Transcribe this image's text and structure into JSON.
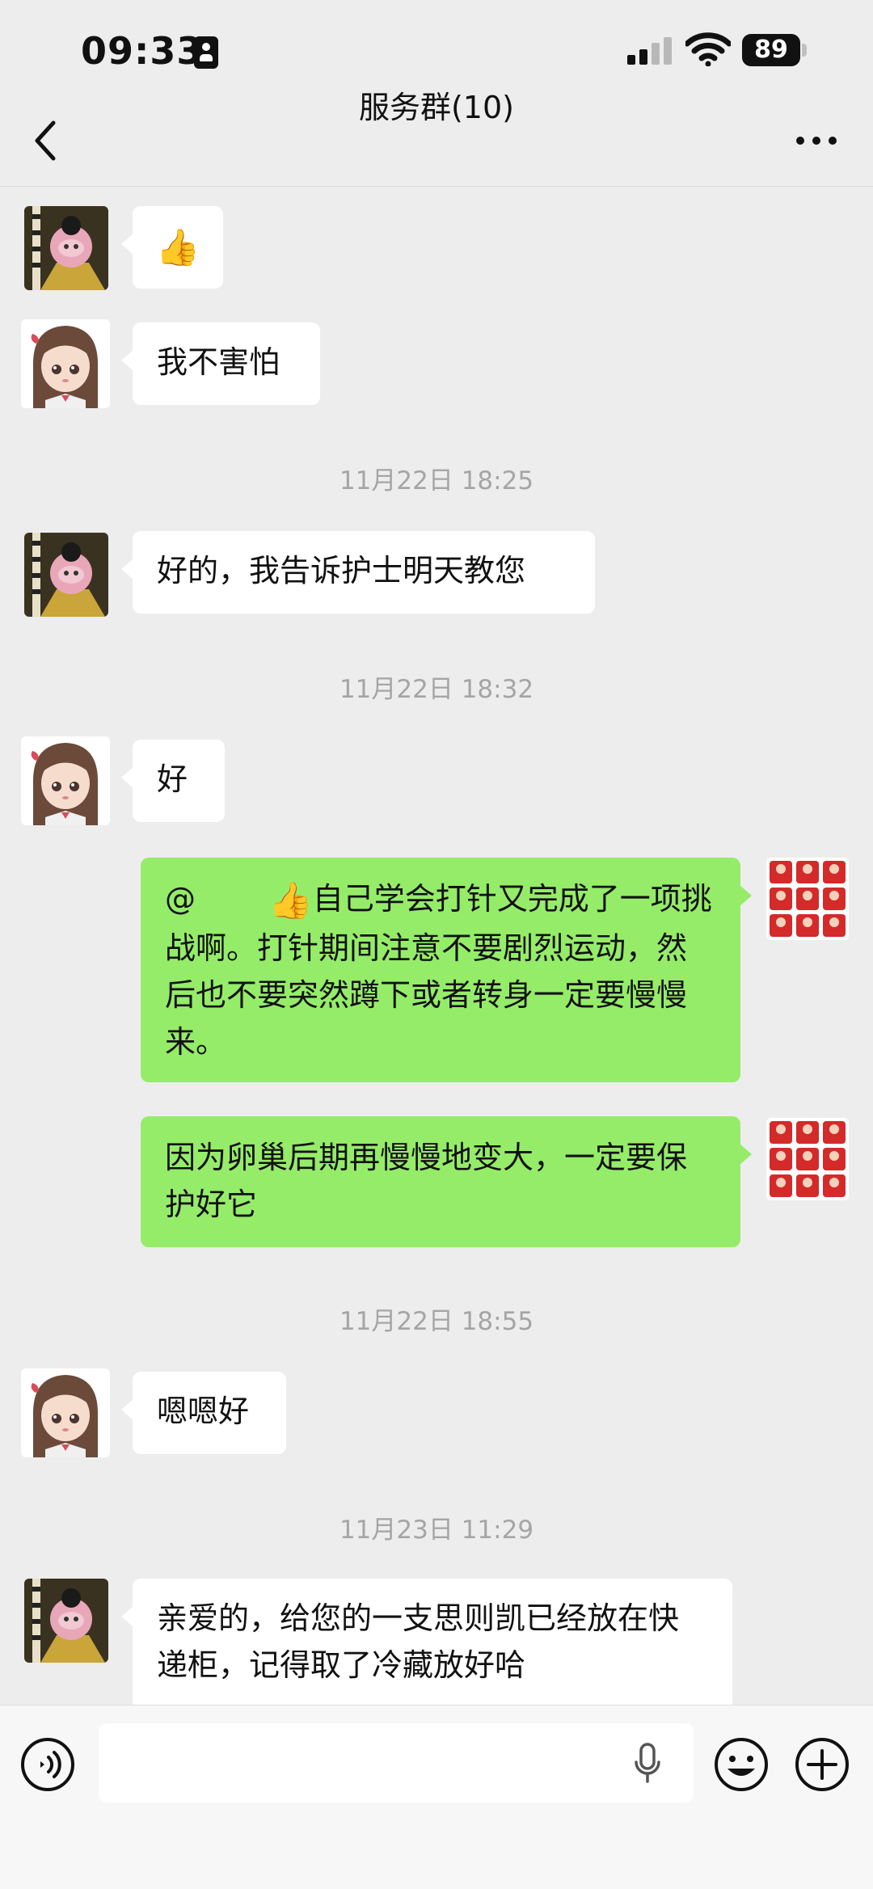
{
  "status_bar": {
    "time": "09:33",
    "battery": "89"
  },
  "header": {
    "title": "服务群(10)"
  },
  "messages": [
    {
      "text": "👍"
    },
    {
      "text": "我不害怕"
    },
    {
      "timestamp": "11月22日 18:25"
    },
    {
      "text": "好的，我告诉护士明天教您"
    },
    {
      "timestamp": "11月22日 18:32"
    },
    {
      "text": "好"
    },
    {
      "mention": "@",
      "emoji": "👍",
      "text": "自己学会打针又完成了一项挑战啊。打针期间注意不要剧烈运动，然后也不要突然蹲下或者转身一定要慢慢来。"
    },
    {
      "text": "因为卵巢后期再慢慢地变大，一定要保护好它"
    },
    {
      "timestamp": "11月22日 18:55"
    },
    {
      "text": "嗯嗯好"
    },
    {
      "timestamp": "11月23日 11:29"
    },
    {
      "text": "亲爱的，给您的一支思则凯已经放在快递柜，记得取了冷藏放好哈"
    }
  ],
  "input_bar": {
    "value": ""
  },
  "colors": {
    "background": "#ededed",
    "bubble_out": "#95ec69",
    "bubble_in": "#ffffff",
    "timestamp": "#a5a5a5"
  }
}
